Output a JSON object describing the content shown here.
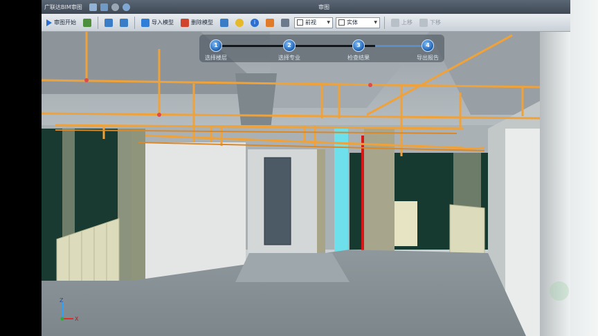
{
  "window": {
    "app_title": "广联达BIM审图",
    "doc_title": "审图"
  },
  "toolbar": {
    "items": [
      {
        "name": "play-button",
        "label": "审图开始",
        "icon": "play-icon",
        "color": "#2a6fd1"
      },
      {
        "name": "document-button",
        "label": "",
        "icon": "document-icon",
        "color": "#4d8f3a"
      },
      {
        "name": "view-button",
        "label": "",
        "icon": "monitor-icon",
        "color": "#3b7cc6"
      },
      {
        "name": "print-button",
        "label": "",
        "icon": "print-icon",
        "color": "#3b7cc6"
      },
      {
        "name": "import-model-button",
        "label": "导入模型",
        "icon": "import-icon",
        "color": "#2f7fd8"
      },
      {
        "name": "delete-model-button",
        "label": "删除模型",
        "icon": "delete-icon",
        "color": "#d0452e"
      },
      {
        "name": "layers-button",
        "label": "",
        "icon": "layers-icon",
        "color": "#3b7cc6"
      },
      {
        "name": "lightbulb-button",
        "label": "",
        "icon": "lightbulb-icon",
        "color": "#e6b92c"
      },
      {
        "name": "info-button",
        "label": "",
        "icon": "info-icon",
        "color": "#2a6fd1"
      },
      {
        "name": "tag-button",
        "label": "",
        "icon": "tag-icon",
        "color": "#e07b2a"
      },
      {
        "name": "lock-button",
        "label": "",
        "icon": "lock-icon",
        "color": "#6b7a8c"
      }
    ],
    "selects": [
      {
        "name": "view-select",
        "value": "前视",
        "icon": "cube-icon"
      },
      {
        "name": "render-select",
        "value": "实体",
        "icon": "render-icon"
      }
    ],
    "disabled": [
      {
        "name": "next-view-button",
        "label": "上移"
      },
      {
        "name": "prev-view-button",
        "label": "下移"
      }
    ]
  },
  "wizard": {
    "steps": [
      {
        "number": "1",
        "label": "选择楼层"
      },
      {
        "number": "2",
        "label": "选择专业"
      },
      {
        "number": "3",
        "label": "检查结果"
      },
      {
        "number": "4",
        "label": "导出报告"
      }
    ]
  },
  "axis": {
    "x_label": "X",
    "z_label": "Z"
  },
  "colors": {
    "pipe": "#f0a23a",
    "sprinkler_red": "#d61818",
    "cyan_column": "#5fdcea",
    "floor": "#8f9aa0",
    "ceiling": "#a9b0b5"
  }
}
